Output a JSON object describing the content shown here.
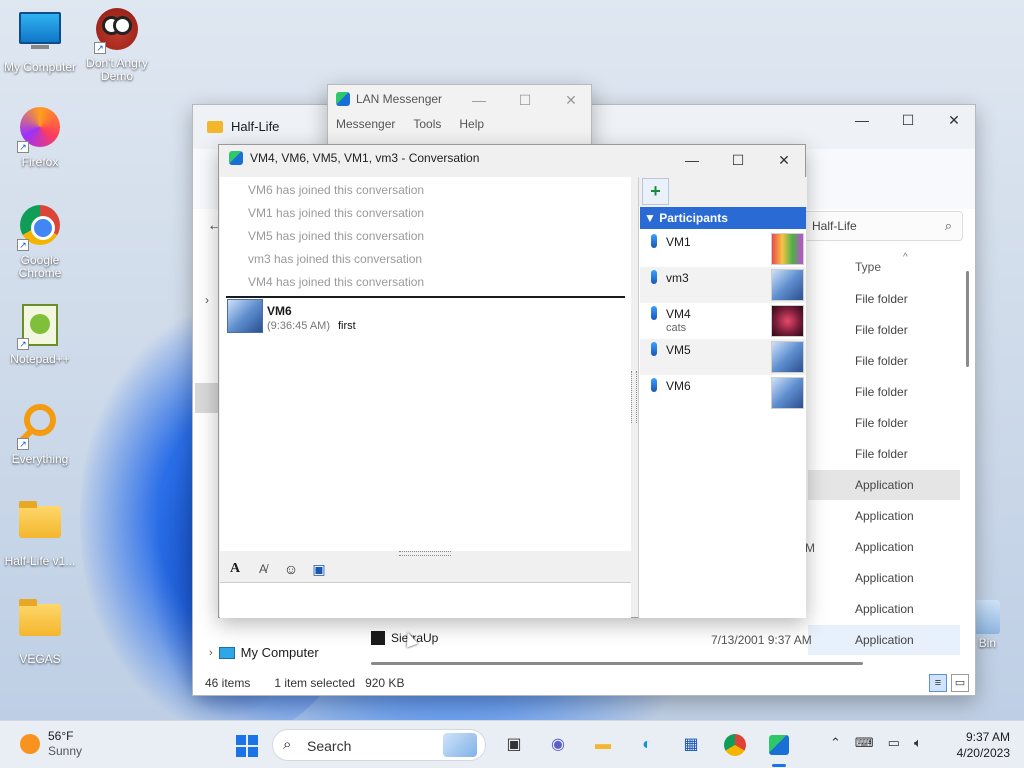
{
  "desktop": {
    "icons": [
      {
        "label": "My Computer",
        "icon": "computer-icon"
      },
      {
        "label": "Don't Angry Demo",
        "icon": "angry-bird-icon"
      },
      {
        "label": "Firefox",
        "icon": "firefox-icon"
      },
      {
        "label": "Google Chrome",
        "icon": "chrome-icon"
      },
      {
        "label": "Notepad++",
        "icon": "notepadpp-icon"
      },
      {
        "label": "Everything",
        "icon": "everything-icon"
      },
      {
        "label": "Half-Life v1...",
        "icon": "folder-icon"
      },
      {
        "label": "VEGAS",
        "icon": "folder-icon"
      }
    ],
    "recycle_partial": "le Bin"
  },
  "explorer": {
    "tab_title": "Half-Life",
    "search_placeholder": "Half-Life",
    "column_type": "Type",
    "rows": [
      "File folder",
      "File folder",
      "File folder",
      "File folder",
      "File folder",
      "File folder",
      "Application",
      "Application",
      "Application",
      "Application",
      "Application",
      "Application"
    ],
    "selected_row_index": 6,
    "partial_letter": "M",
    "nav_my_computer": "My Computer",
    "file_item_name": "SierraUp",
    "file_item_date": "7/13/2001 9:37 AM",
    "status_items": "46 items",
    "status_selected": "1 item selected",
    "status_size": "920 KB"
  },
  "lan_messenger": {
    "title": "LAN Messenger",
    "menu": [
      "Messenger",
      "Tools",
      "Help"
    ]
  },
  "conversation": {
    "title": "VM4, VM6, VM5, VM1, vm3 - Conversation",
    "system_messages": [
      "VM6 has joined this conversation",
      "VM1 has joined this conversation",
      "VM5 has joined this conversation",
      "vm3 has joined this conversation",
      "VM4 has joined this conversation"
    ],
    "message": {
      "sender": "VM6",
      "time": "(9:36:45 AM)",
      "text": "first"
    },
    "participants_header": "Participants",
    "participants": [
      {
        "name": "VM1",
        "note": ""
      },
      {
        "name": "vm3",
        "note": ""
      },
      {
        "name": "VM4",
        "note": "cats"
      },
      {
        "name": "VM5",
        "note": ""
      },
      {
        "name": "VM6",
        "note": ""
      }
    ]
  },
  "taskbar": {
    "temperature": "56°F",
    "condition": "Sunny",
    "search_label": "Search",
    "time": "9:37 AM",
    "date": "4/20/2023"
  }
}
